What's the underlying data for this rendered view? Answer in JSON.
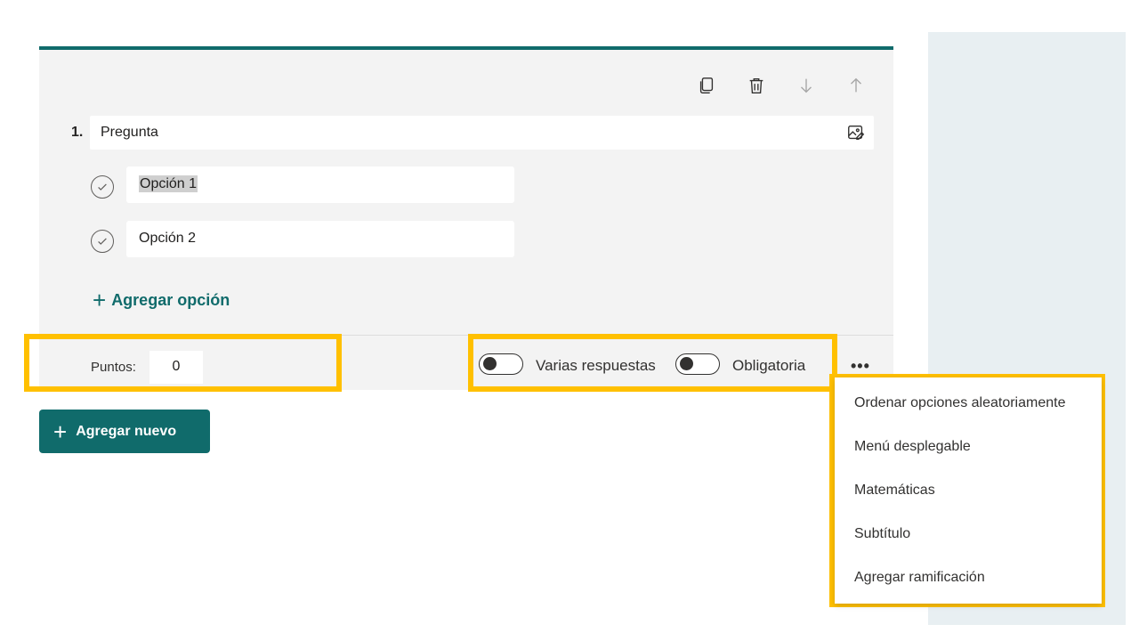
{
  "question": {
    "number": "1.",
    "text": "Pregunta",
    "options": [
      {
        "label": "Opción 1",
        "selected_text": true
      },
      {
        "label": "Opción 2",
        "selected_text": false
      }
    ],
    "add_option_label": "Agregar opción"
  },
  "toolbar": {
    "icons": [
      "copy-icon",
      "trash-icon",
      "arrow-down-icon",
      "arrow-up-icon"
    ]
  },
  "footer": {
    "points_label": "Puntos:",
    "points_value": "0",
    "multiple_answers_label": "Varias respuestas",
    "multiple_answers_on": false,
    "required_label": "Obligatoria",
    "required_on": false,
    "more_label": "•••"
  },
  "add_new_label": "Agregar nuevo",
  "more_menu": {
    "items": [
      "Ordenar opciones aleatoriamente",
      "Menú desplegable",
      "Matemáticas",
      "Subtítulo",
      "Agregar ramificación"
    ]
  },
  "colors": {
    "accent": "#106b6b",
    "highlight": "#ffc000",
    "side_panel": "#e8eff2"
  }
}
